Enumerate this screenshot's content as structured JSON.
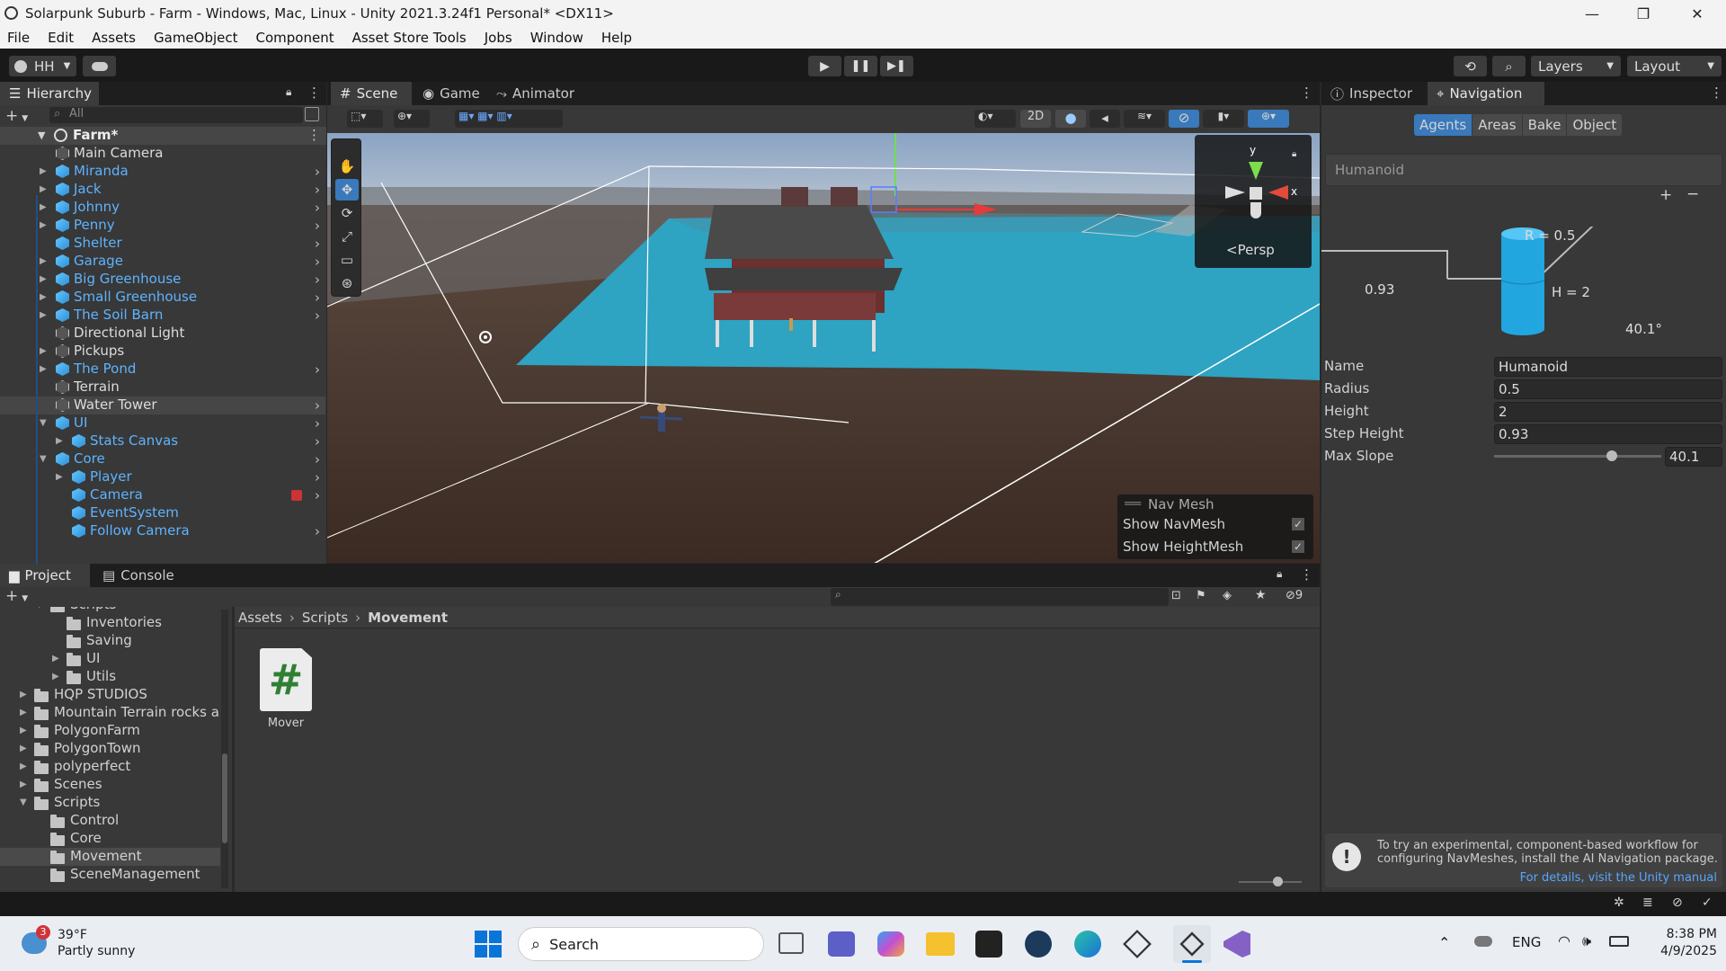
{
  "window": {
    "title": "Solarpunk Suburb - Farm - Windows, Mac, Linux - Unity 2021.3.24f1 Personal* <DX11>",
    "controls": [
      "—",
      "❐",
      "✕"
    ]
  },
  "menu": [
    "File",
    "Edit",
    "Assets",
    "GameObject",
    "Component",
    "Asset Store Tools",
    "Jobs",
    "Window",
    "Help"
  ],
  "toolbar": {
    "account": "HH",
    "layers": "Layers",
    "layout": "Layout"
  },
  "hierarchy": {
    "tab": "Hierarchy",
    "search_placeholder": "All",
    "scene": "Farm*",
    "items": [
      {
        "label": "Main Camera",
        "color": "white",
        "icon": "cube-outline",
        "arrow": false,
        "chev": false,
        "indent": 0
      },
      {
        "label": "Miranda",
        "color": "blue",
        "icon": "prefab",
        "arrow": true,
        "chev": true,
        "indent": 0
      },
      {
        "label": "Jack",
        "color": "blue",
        "icon": "prefab",
        "arrow": true,
        "chev": true,
        "indent": 0
      },
      {
        "label": "Johnny",
        "color": "blue",
        "icon": "prefab",
        "arrow": true,
        "chev": true,
        "indent": 0
      },
      {
        "label": "Penny",
        "color": "blue",
        "icon": "prefab",
        "arrow": true,
        "chev": true,
        "indent": 0
      },
      {
        "label": "Shelter",
        "color": "blue",
        "icon": "prefab",
        "arrow": false,
        "chev": true,
        "indent": 0
      },
      {
        "label": "Garage",
        "color": "blue",
        "icon": "prefab",
        "arrow": true,
        "chev": true,
        "indent": 0
      },
      {
        "label": "Big Greenhouse",
        "color": "blue",
        "icon": "prefab",
        "arrow": true,
        "chev": true,
        "indent": 0
      },
      {
        "label": "Small Greenhouse",
        "color": "blue",
        "icon": "prefab",
        "arrow": true,
        "chev": true,
        "indent": 0
      },
      {
        "label": "The Soil Barn",
        "color": "blue",
        "icon": "prefab",
        "arrow": true,
        "chev": true,
        "indent": 0
      },
      {
        "label": "Directional Light",
        "color": "white",
        "icon": "cube-outline",
        "arrow": false,
        "chev": false,
        "indent": 0
      },
      {
        "label": "Pickups",
        "color": "white",
        "icon": "cube-outline",
        "arrow": true,
        "chev": false,
        "indent": 0
      },
      {
        "label": "The Pond",
        "color": "blue",
        "icon": "prefab",
        "arrow": true,
        "chev": true,
        "indent": 0
      },
      {
        "label": "Terrain",
        "color": "white",
        "icon": "cube-outline",
        "arrow": false,
        "chev": false,
        "indent": 0
      },
      {
        "label": "Water Tower",
        "color": "white",
        "icon": "cube-outline",
        "arrow": false,
        "chev": true,
        "indent": 0,
        "selected": true
      },
      {
        "label": "UI",
        "color": "blue",
        "icon": "prefab",
        "arrow": true,
        "chev": true,
        "indent": 0,
        "open": true
      },
      {
        "label": "Stats Canvas",
        "color": "blue",
        "icon": "prefab",
        "arrow": true,
        "chev": true,
        "indent": 1
      },
      {
        "label": "Core",
        "color": "blue",
        "icon": "prefab",
        "arrow": true,
        "chev": true,
        "indent": 0,
        "open": true
      },
      {
        "label": "Player",
        "color": "blue",
        "icon": "prefab",
        "arrow": true,
        "chev": true,
        "indent": 1
      },
      {
        "label": "Camera",
        "color": "blue",
        "icon": "prefab",
        "arrow": false,
        "chev": true,
        "indent": 1,
        "badge": true
      },
      {
        "label": "EventSystem",
        "color": "blue",
        "icon": "prefab",
        "arrow": false,
        "chev": false,
        "indent": 1
      },
      {
        "label": "Follow Camera",
        "color": "blue",
        "icon": "prefab",
        "arrow": false,
        "chev": true,
        "indent": 1
      }
    ]
  },
  "scene_tabs": [
    "Scene",
    "Game",
    "Animator"
  ],
  "scene": {
    "persp": "<Persp",
    "gizmo_y": "y",
    "gizmo_x": "x",
    "mode_2d": "2D",
    "navmesh_overlay": {
      "title": "Nav Mesh",
      "show_navmesh": "Show NavMesh",
      "show_heightmesh": "Show HeightMesh"
    }
  },
  "project": {
    "tabs": [
      "Project",
      "Console"
    ],
    "tree": [
      {
        "label": "Scripts",
        "depth": 1,
        "arrow": "open",
        "partial": true
      },
      {
        "label": "Inventories",
        "depth": 2,
        "arrow": "none"
      },
      {
        "label": "Saving",
        "depth": 2,
        "arrow": "none"
      },
      {
        "label": "UI",
        "depth": 2,
        "arrow": "closed"
      },
      {
        "label": "Utils",
        "depth": 2,
        "arrow": "closed"
      },
      {
        "label": "HQP STUDIOS",
        "depth": 0,
        "arrow": "closed"
      },
      {
        "label": "Mountain Terrain rocks a",
        "depth": 0,
        "arrow": "closed"
      },
      {
        "label": "PolygonFarm",
        "depth": 0,
        "arrow": "closed"
      },
      {
        "label": "PolygonTown",
        "depth": 0,
        "arrow": "closed"
      },
      {
        "label": "polyperfect",
        "depth": 0,
        "arrow": "closed"
      },
      {
        "label": "Scenes",
        "depth": 0,
        "arrow": "closed"
      },
      {
        "label": "Scripts",
        "depth": 0,
        "arrow": "open"
      },
      {
        "label": "Control",
        "depth": 1,
        "arrow": "none"
      },
      {
        "label": "Core",
        "depth": 1,
        "arrow": "none"
      },
      {
        "label": "Movement",
        "depth": 1,
        "arrow": "none",
        "selected": true
      },
      {
        "label": "SceneManagement",
        "depth": 1,
        "arrow": "none"
      }
    ],
    "breadcrumb": [
      "Assets",
      "Scripts",
      "Movement"
    ],
    "asset": {
      "name": "Mover",
      "glyph": "#"
    },
    "hidden_count": "9"
  },
  "inspector": {
    "tabs": [
      "Inspector",
      "Navigation"
    ],
    "nav_tabs": [
      "Agents",
      "Areas",
      "Bake",
      "Object"
    ],
    "agent_list_item": "Humanoid",
    "diagram": {
      "r": "R = 0.5",
      "h": "H = 2",
      "step": "0.93",
      "slope": "40.1°"
    },
    "fields": {
      "name_label": "Name",
      "name": "Humanoid",
      "radius_label": "Radius",
      "radius": "0.5",
      "height_label": "Height",
      "height": "2",
      "step_label": "Step Height",
      "step": "0.93",
      "slope_label": "Max Slope",
      "slope": "40.1",
      "slope_fraction": 0.67
    },
    "info": "To try an experimental, component-based workflow for configuring NavMeshes, install the AI Navigation package.",
    "info_link": "For details, visit the Unity manual"
  },
  "taskbar": {
    "weather_temp": "39°F",
    "weather_desc": "Partly sunny",
    "weather_badge": "3",
    "search": "Search",
    "lang": "ENG",
    "time": "8:38 PM",
    "date": "4/9/2025"
  },
  "colors": {
    "accent": "#3a79bb",
    "water": "#2ea3c2",
    "ground": "#3d2a20",
    "prefab": "#5fb3ff"
  }
}
